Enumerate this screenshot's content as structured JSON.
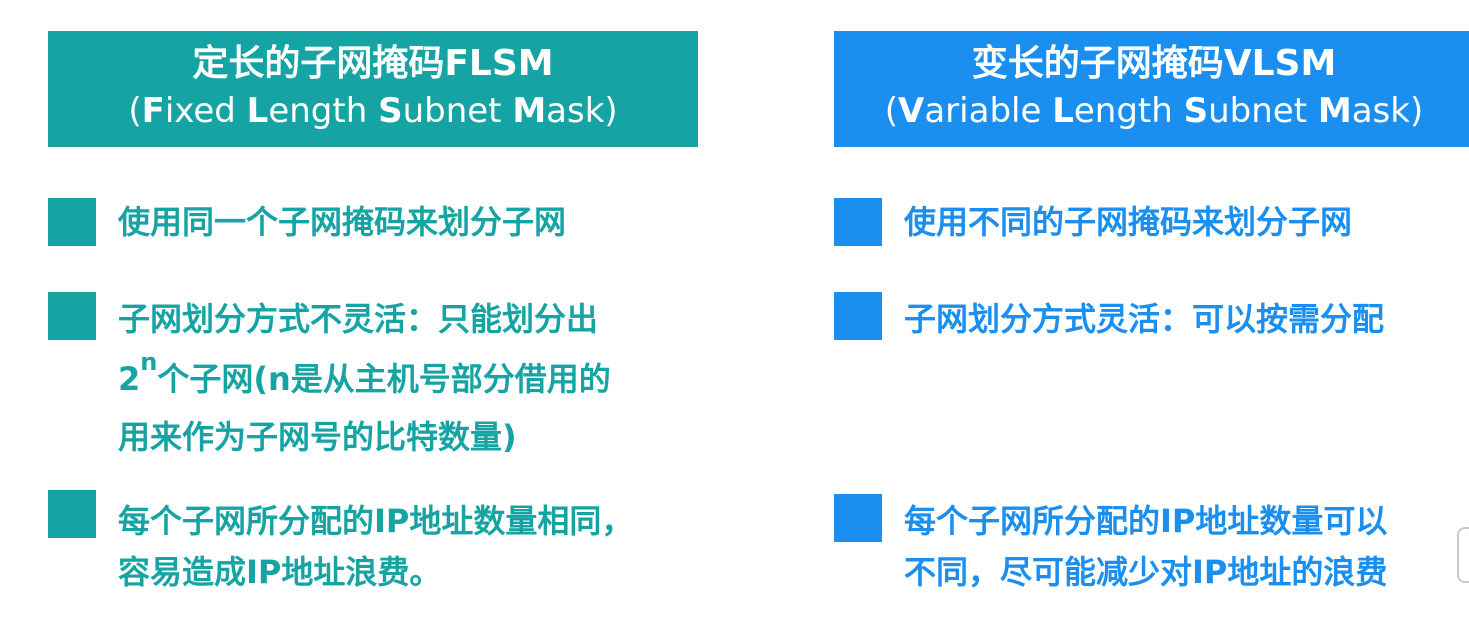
{
  "flsm": {
    "title": "定长的子网掩码FLSM",
    "subtitle_open": "(",
    "subtitle_w1_initial": "F",
    "subtitle_w1_rest": "ixed ",
    "subtitle_w2_initial": "L",
    "subtitle_w2_rest": "ength ",
    "subtitle_w3_initial": "S",
    "subtitle_w3_rest": "ubnet ",
    "subtitle_w4_initial": "M",
    "subtitle_w4_rest": "ask)",
    "item1": "使用同一个子网掩码来划分子网",
    "item2_line1": "子网划分方式不灵活：只能划分出",
    "item2_base": "2",
    "item2_exp": "n",
    "item2_line2_rest": "个子网(n是从主机号部分借用的",
    "item2_line3": "用来作为子网号的比特数量)",
    "item3_line1": "每个子网所分配的IP地址数量相同，",
    "item3_line2": "容易造成IP地址浪费。"
  },
  "vlsm": {
    "title": "变长的子网掩码VLSM",
    "subtitle_open": "(",
    "subtitle_w1_initial": "V",
    "subtitle_w1_rest": "ariable ",
    "subtitle_w2_initial": "L",
    "subtitle_w2_rest": "ength ",
    "subtitle_w3_initial": "S",
    "subtitle_w3_rest": "ubnet ",
    "subtitle_w4_initial": "M",
    "subtitle_w4_rest": "ask)",
    "item1": "使用不同的子网掩码来划分子网",
    "item2": "子网划分方式灵活：可以按需分配",
    "item3_line1": "每个子网所分配的IP地址数量可以",
    "item3_line2": "不同，尽可能减少对IP地址的浪费"
  },
  "colors": {
    "flsm_accent": "#15a3a3",
    "vlsm_accent": "#1a8ff0"
  }
}
